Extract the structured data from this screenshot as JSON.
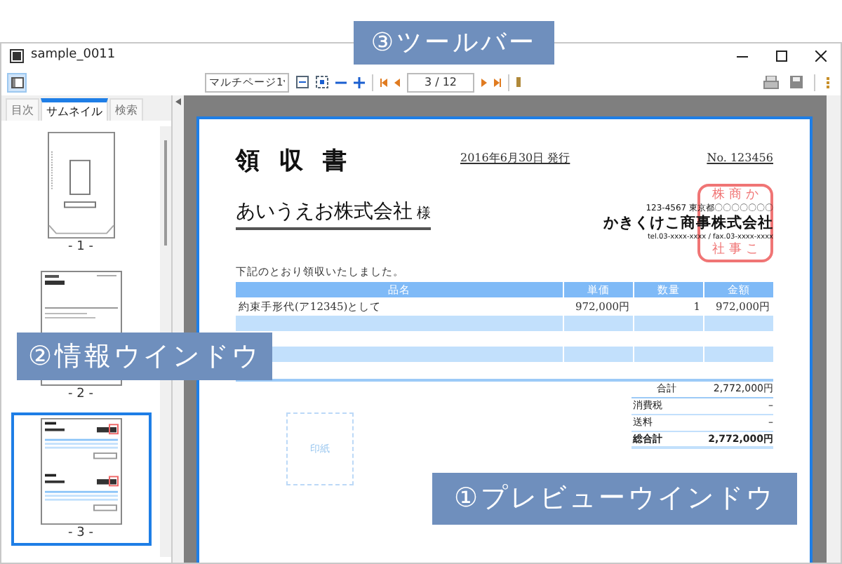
{
  "window": {
    "title": "sample_0011"
  },
  "toolbar": {
    "zoom_mode": "マルチページ1",
    "page_field": "3 / 12"
  },
  "tabs": [
    {
      "label": "目次",
      "selected": false
    },
    {
      "label": "サムネイル",
      "selected": true
    },
    {
      "label": "検索",
      "selected": false
    }
  ],
  "thumbnails": [
    {
      "kind": "envelope",
      "label": "- 1 -",
      "selected": false
    },
    {
      "kind": "letter",
      "label": "- 2 -",
      "selected": false
    },
    {
      "kind": "receipt",
      "label": "- 3 -",
      "selected": true
    }
  ],
  "document": {
    "title": "領 収 書",
    "date": "2016年6月30日 発行",
    "number": "No. 123456",
    "customer": "あいうえお株式会社",
    "honorific": "様",
    "issuer": {
      "address": "123-4567 東京都〇〇〇〇〇〇〇",
      "name": "かきくけこ商事株式会社",
      "contact": "tel.03-xxxx-xxxx / fax.03-xxxx-xxxx"
    },
    "stamp": [
      "株 商 か",
      "社 事 こ"
    ],
    "note": "下記のとおり領収いたしました。",
    "table": {
      "columns": [
        "品名",
        "単価",
        "数量",
        "金額"
      ],
      "rows": [
        [
          "約束手形代(ア12345)として",
          "972,000円",
          "1",
          "972,000円"
        ]
      ]
    },
    "totals": [
      {
        "label": "合計",
        "value": "2,772,000円",
        "bold": false
      },
      {
        "label": "消費税",
        "value": "–",
        "bold": false
      },
      {
        "label": "送料",
        "value": "–",
        "bold": false
      },
      {
        "label": "総合計",
        "value": "2,772,000円",
        "bold": true
      }
    ],
    "revenue_stamp": "印紙"
  },
  "callouts": [
    {
      "kind": "toolbar",
      "text": "③ツールバー"
    },
    {
      "kind": "info",
      "text": "②情報ウインドウ"
    },
    {
      "kind": "preview",
      "text": "①プレビューウインドウ"
    }
  ]
}
